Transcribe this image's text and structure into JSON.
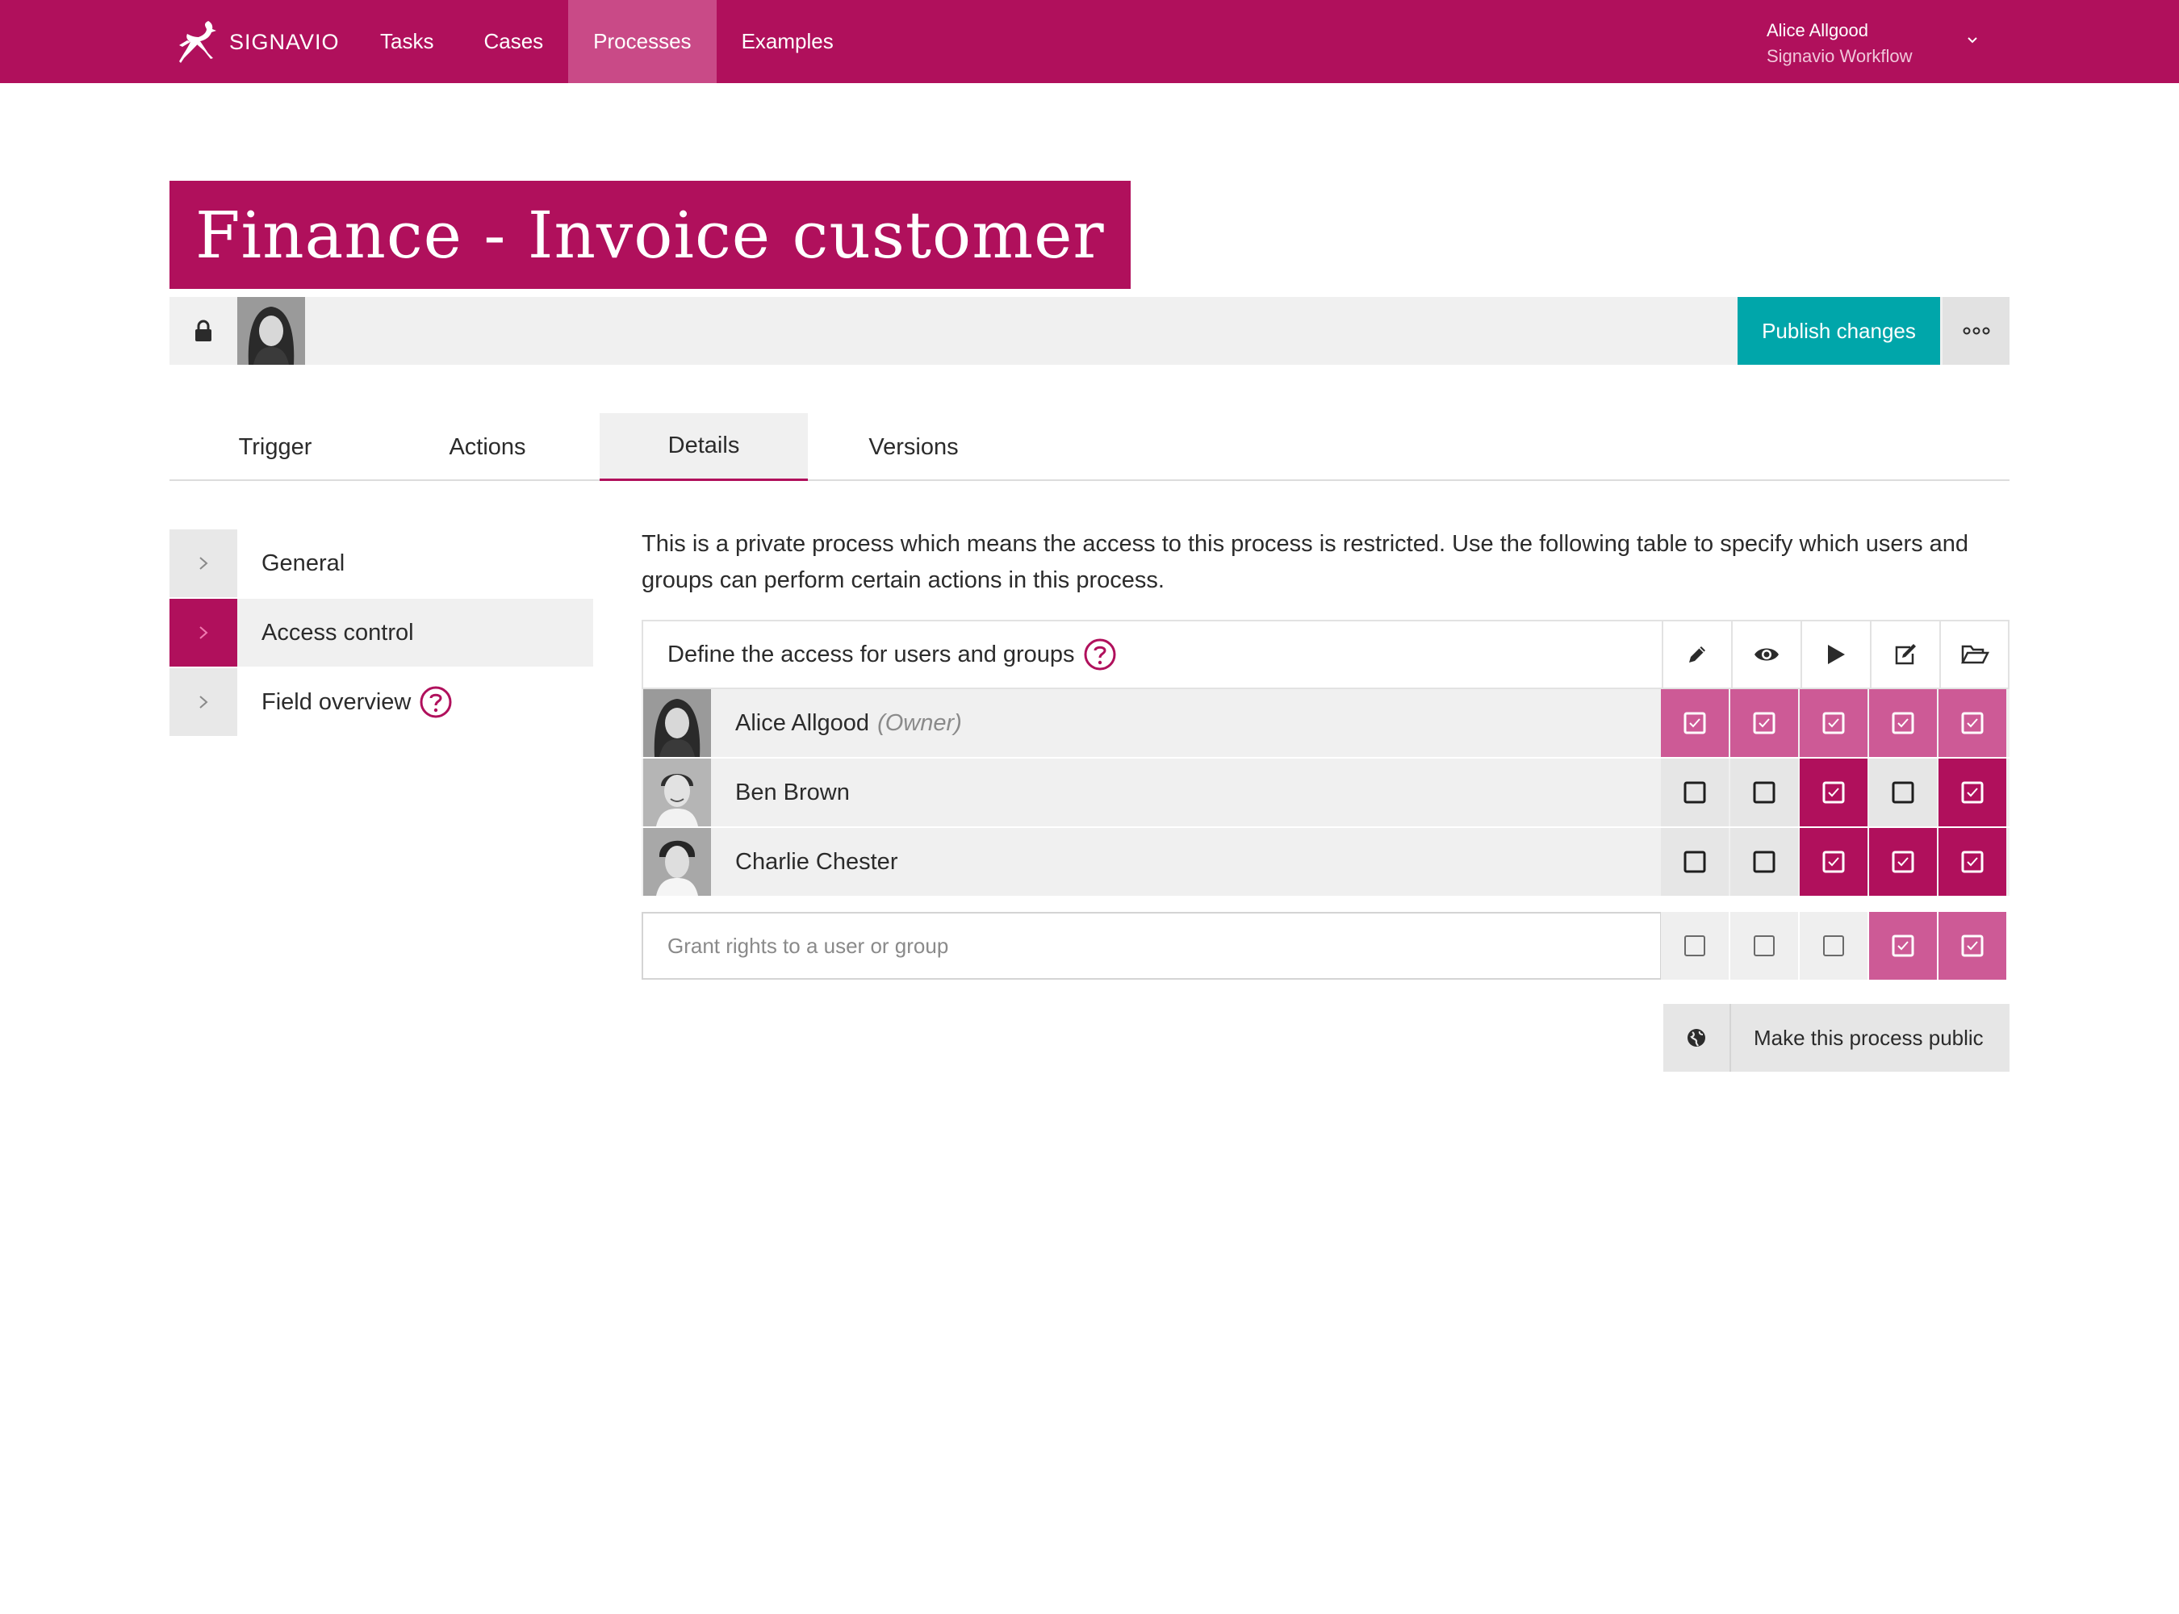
{
  "app": {
    "brand": "SIGNAVIO",
    "nav": [
      "Tasks",
      "Cases",
      "Processes",
      "Examples"
    ],
    "active_nav": "Processes",
    "user": {
      "name": "Alice Allgood",
      "org": "Signavio Workflow"
    }
  },
  "process": {
    "title": "Finance - Invoice customer",
    "publish_label": "Publish changes",
    "tabs": [
      "Trigger",
      "Actions",
      "Details",
      "Versions"
    ],
    "active_tab": "Details"
  },
  "side_menu": {
    "items": [
      "General",
      "Access control",
      "Field overview"
    ],
    "active": "Access control"
  },
  "access": {
    "intro": "This is a private process which means the access to this process is restricted. Use the following table to specify which users and groups can perform certain actions in this process.",
    "header": "Define the access for users and groups",
    "columns": [
      "edit-pencil-icon",
      "view-eye-icon",
      "start-play-icon",
      "edit-note-icon",
      "open-folder-icon"
    ],
    "rows": [
      {
        "name": "Alice Allgood",
        "role": "(Owner)",
        "checked": [
          true,
          true,
          true,
          true,
          true
        ],
        "styles": [
          "light",
          "light",
          "light",
          "light",
          "light"
        ]
      },
      {
        "name": "Ben Brown",
        "role": "",
        "checked": [
          false,
          false,
          true,
          false,
          true
        ],
        "styles": [
          "grey",
          "grey",
          "dark",
          "grey",
          "dark"
        ]
      },
      {
        "name": "Charlie Chester",
        "role": "",
        "checked": [
          false,
          false,
          true,
          true,
          true
        ],
        "styles": [
          "grey",
          "grey",
          "dark",
          "dark",
          "dark"
        ]
      }
    ],
    "grant": {
      "placeholder": "Grant rights to a user or group",
      "checked": [
        false,
        false,
        false,
        true,
        true
      ]
    },
    "public_label": "Make this process public"
  },
  "colors": {
    "brand": "#b0105c",
    "brand_light": "#cd5a96",
    "publish": "#00a6aa"
  }
}
